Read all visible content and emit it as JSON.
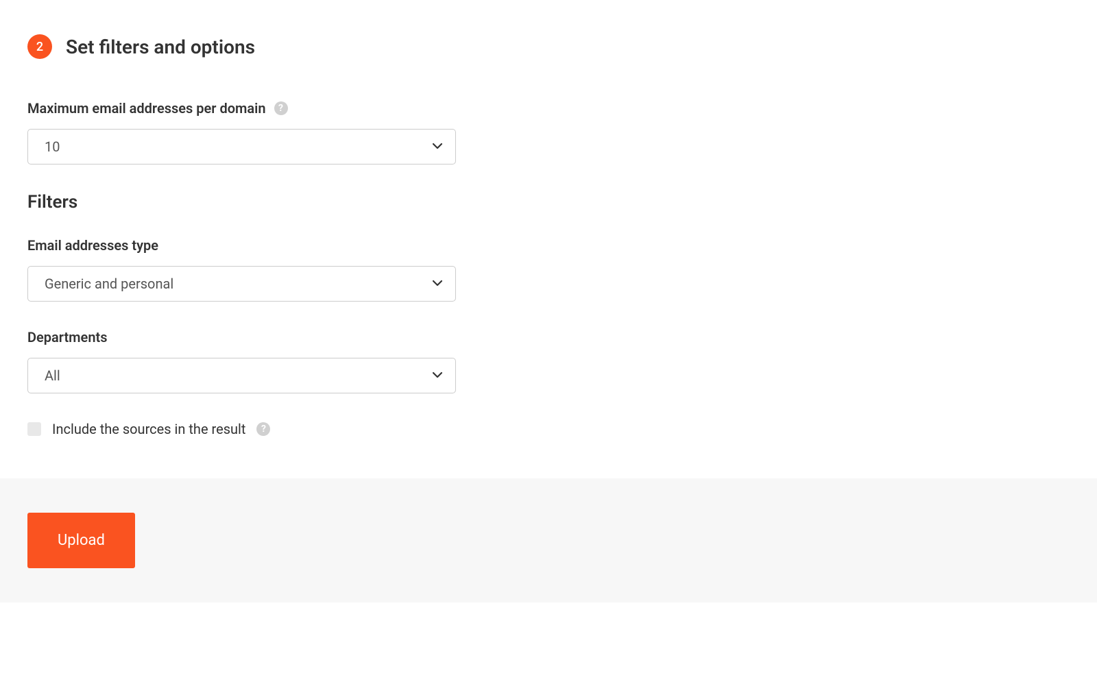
{
  "step": {
    "number": "2",
    "title": "Set filters and options"
  },
  "max_emails": {
    "label": "Maximum email addresses per domain",
    "value": "10"
  },
  "filters_heading": "Filters",
  "email_type": {
    "label": "Email addresses type",
    "value": "Generic and personal"
  },
  "departments": {
    "label": "Departments",
    "value": "All"
  },
  "include_sources": {
    "label": "Include the sources in the result"
  },
  "footer": {
    "upload_label": "Upload"
  },
  "colors": {
    "accent": "#fa5320"
  }
}
